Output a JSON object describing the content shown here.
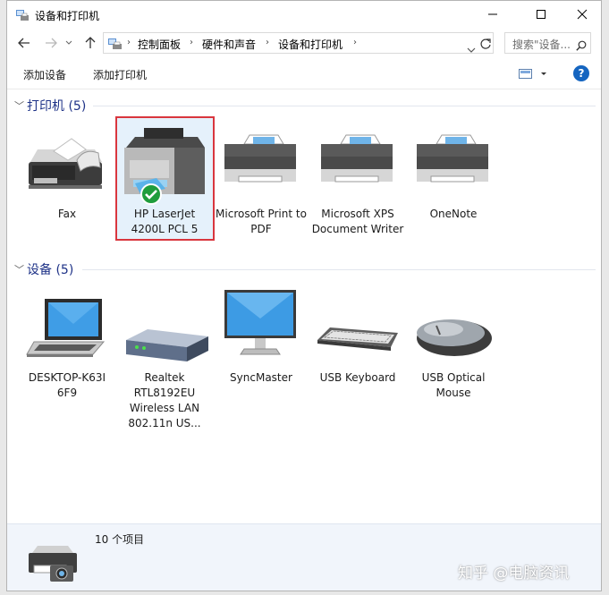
{
  "window": {
    "title": "设备和打印机"
  },
  "address": {
    "crumbs": [
      "控制面板",
      "硬件和声音",
      "设备和打印机"
    ],
    "search_placeholder": "搜索\"设备..."
  },
  "commands": {
    "add_device": "添加设备",
    "add_printer": "添加打印机"
  },
  "groups": {
    "printers": {
      "title": "打印机 (5)",
      "items": [
        {
          "label": "Fax",
          "icon": "fax-icon"
        },
        {
          "label": "HP LaserJet 4200L PCL 5",
          "icon": "printer-icon",
          "selected": true,
          "default": true
        },
        {
          "label": "Microsoft Print to PDF",
          "icon": "printer-icon"
        },
        {
          "label": "Microsoft XPS Document Writer",
          "icon": "printer-icon"
        },
        {
          "label": "OneNote",
          "icon": "printer-icon"
        }
      ]
    },
    "devices": {
      "title": "设备 (5)",
      "items": [
        {
          "label": "DESKTOP-K63I 6F9",
          "icon": "laptop-icon"
        },
        {
          "label": "Realtek RTL8192EU Wireless LAN 802.11n US...",
          "icon": "network-adapter-icon"
        },
        {
          "label": "SyncMaster",
          "icon": "monitor-icon"
        },
        {
          "label": "USB Keyboard",
          "icon": "keyboard-icon"
        },
        {
          "label": "USB Optical Mouse",
          "icon": "mouse-icon"
        }
      ]
    }
  },
  "status": {
    "count": "10 个项目"
  },
  "watermark": "知乎 @电脑资讯",
  "colors": {
    "accent": "#0078d7",
    "selection_border": "#d9363e",
    "group_title": "#1e3287"
  }
}
